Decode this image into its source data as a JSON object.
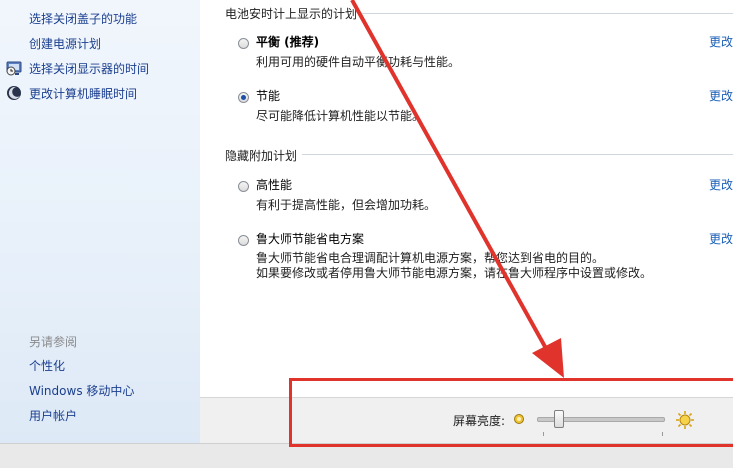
{
  "sidebar": {
    "links": [
      {
        "label": "选择关闭盖子的功能"
      },
      {
        "label": "创建电源计划"
      },
      {
        "label": "选择关闭显示器的时间",
        "icon": "monitor-clock-icon"
      },
      {
        "label": "更改计算机睡眠时间",
        "icon": "moon-icon"
      }
    ],
    "see_also": {
      "title": "另请参阅",
      "links": [
        {
          "label": "个性化"
        },
        {
          "label": "Windows 移动中心"
        },
        {
          "label": "用户帐户"
        }
      ]
    }
  },
  "main": {
    "battery_section": {
      "title": "电池安时计上显示的计划"
    },
    "plans": [
      {
        "name": "平衡 (推荐)",
        "description": "利用可用的硬件自动平衡功耗与性能。",
        "selected": false,
        "change_label": "更改"
      },
      {
        "name": "节能",
        "description": "尽可能降低计算机性能以节能。",
        "selected": true,
        "change_label": "更改"
      }
    ],
    "hidden_section": {
      "title": "隐藏附加计划"
    },
    "hidden_plans": [
      {
        "name": "高性能",
        "description": "有利于提高性能，但会增加功耗。",
        "selected": false,
        "change_label": "更改"
      },
      {
        "name": "鲁大师节能省电方案",
        "description_line1": "鲁大师节能省电合理调配计算机电源方案，帮您达到省电的目的。",
        "description_line2": "如果要修改或者停用鲁大师节能电源方案，请在鲁大师程序中设置或修改。",
        "selected": false,
        "change_label": "更改"
      }
    ]
  },
  "bottom": {
    "brightness_label": "屏幕亮度:",
    "brightness_level_percent": 15,
    "dim_icon": "sun-small-icon",
    "bright_icon": "sun-large-icon"
  },
  "colors": {
    "annotation": "#e0332c",
    "link": "#1b5fb8",
    "nav_link": "#1b3f8f"
  }
}
